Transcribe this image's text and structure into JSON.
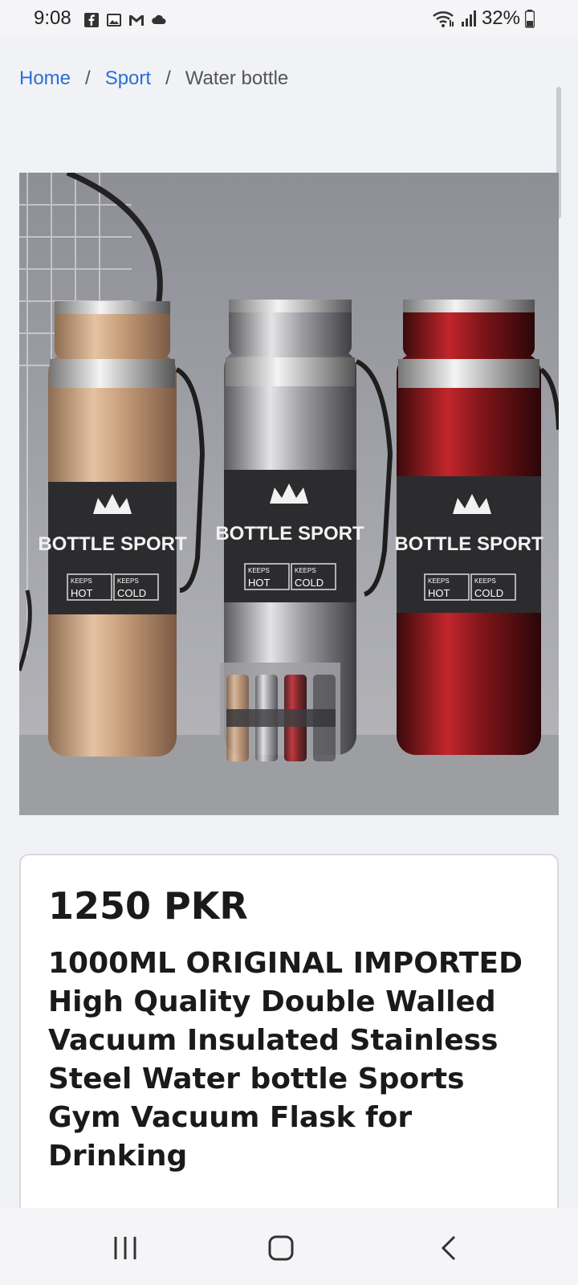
{
  "status_bar": {
    "time": "9:08",
    "notification_icons": [
      "facebook-icon",
      "image-icon",
      "gmail-icon",
      "cloud-icon"
    ],
    "system_icons": [
      "wifi-icon",
      "signal-icon",
      "battery-icon"
    ],
    "battery_percent": "32%"
  },
  "breadcrumb": {
    "items": [
      "Home",
      "Sport",
      "Water bottle"
    ],
    "separator": "/"
  },
  "product": {
    "image_labels": [
      "BOTTLE SPORT",
      "BOTTLE SPORT",
      "BOTTLE SPORT"
    ],
    "image_badge_hot": "HOT",
    "image_badge_cold": "COLD",
    "image_badge_keeps": "KEEPS",
    "price": "1250 PKR",
    "title": "1000ML ORIGINAL IMPORTED High Quality Double Walled Vacuum Insulated Stainless Steel Water bottle Sports Gym Vacuum Flask for Drinking"
  },
  "nav_bar": {
    "buttons": [
      "recent-apps",
      "home",
      "back"
    ]
  },
  "colors": {
    "link": "#2a6fd6",
    "bottle_gold": "#c9a27e",
    "bottle_silver": "#a9a9ad",
    "bottle_red": "#8e1a1e"
  }
}
